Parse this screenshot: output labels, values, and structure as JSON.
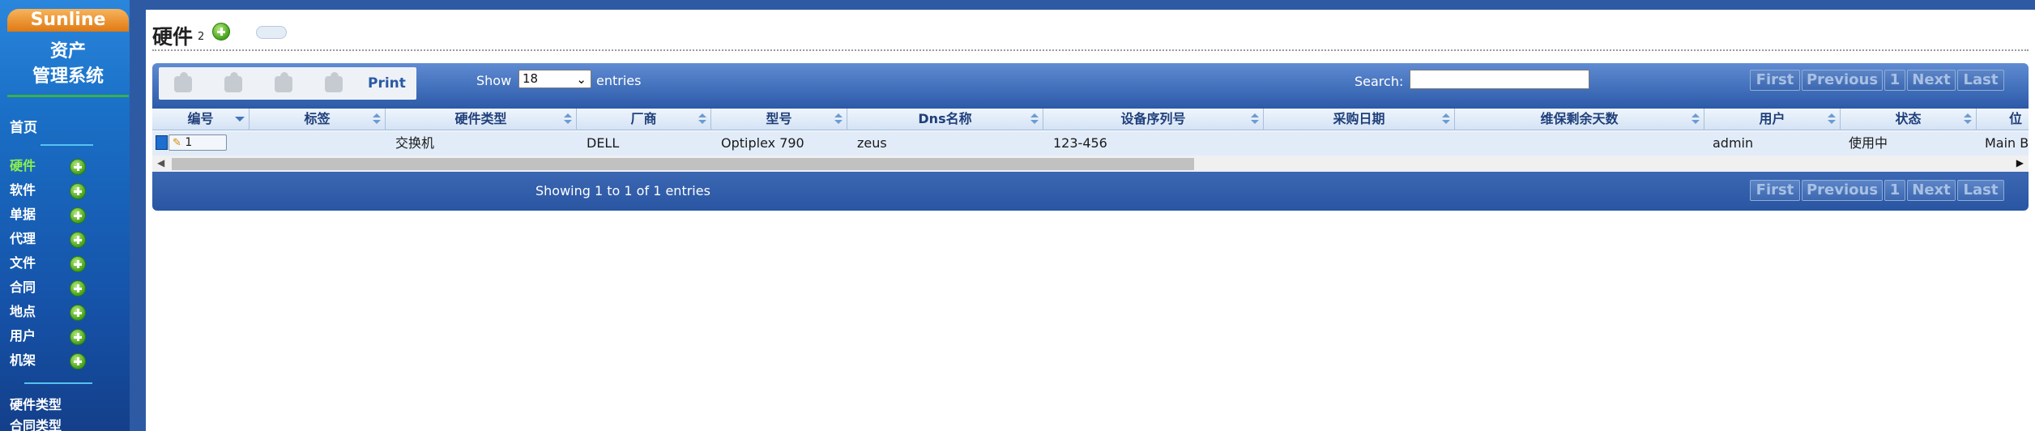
{
  "sidebar": {
    "brand": "Sunline",
    "title_line1": "资产",
    "title_line2": "管理系统",
    "home": "首页",
    "items": [
      {
        "label": "硬件",
        "active": true
      },
      {
        "label": "软件"
      },
      {
        "label": "单据"
      },
      {
        "label": "代理"
      },
      {
        "label": "文件"
      },
      {
        "label": "合同"
      },
      {
        "label": "地点"
      },
      {
        "label": "用户"
      },
      {
        "label": "机架"
      }
    ],
    "sub_items": [
      "硬件类型",
      "合同类型"
    ]
  },
  "page": {
    "title": "硬件",
    "count": "2"
  },
  "toolbar": {
    "print_label": "Print",
    "show_label": "Show",
    "page_length": "18",
    "entries_label": "entries",
    "search_label": "Search:",
    "search_value": ""
  },
  "pagination": {
    "first": "First",
    "previous": "Previous",
    "current": "1",
    "next": "Next",
    "last": "Last"
  },
  "table": {
    "columns": [
      "编号",
      "标签",
      "硬件类型",
      "厂商",
      "型号",
      "Dns名称",
      "设备序列号",
      "采购日期",
      "维保剩余天数",
      "用户",
      "状态",
      "位"
    ],
    "rows": [
      {
        "id": "1",
        "tag": "",
        "type": "交换机",
        "vendor": "DELL",
        "model": "Optiplex 790",
        "dns": "zeus",
        "serial": "123-456",
        "purchase_date": "",
        "warranty_days": "",
        "user": "admin",
        "status": "使用中",
        "location": "Main Bu"
      }
    ]
  },
  "footer": {
    "info": "Showing 1 to 1 of 1 entries"
  },
  "colors": {
    "background": "#2d5aa3",
    "sidebar_active": "#8cf04a",
    "header_bar": "#2c5aa8",
    "row_bg": "#e2ecf9"
  }
}
